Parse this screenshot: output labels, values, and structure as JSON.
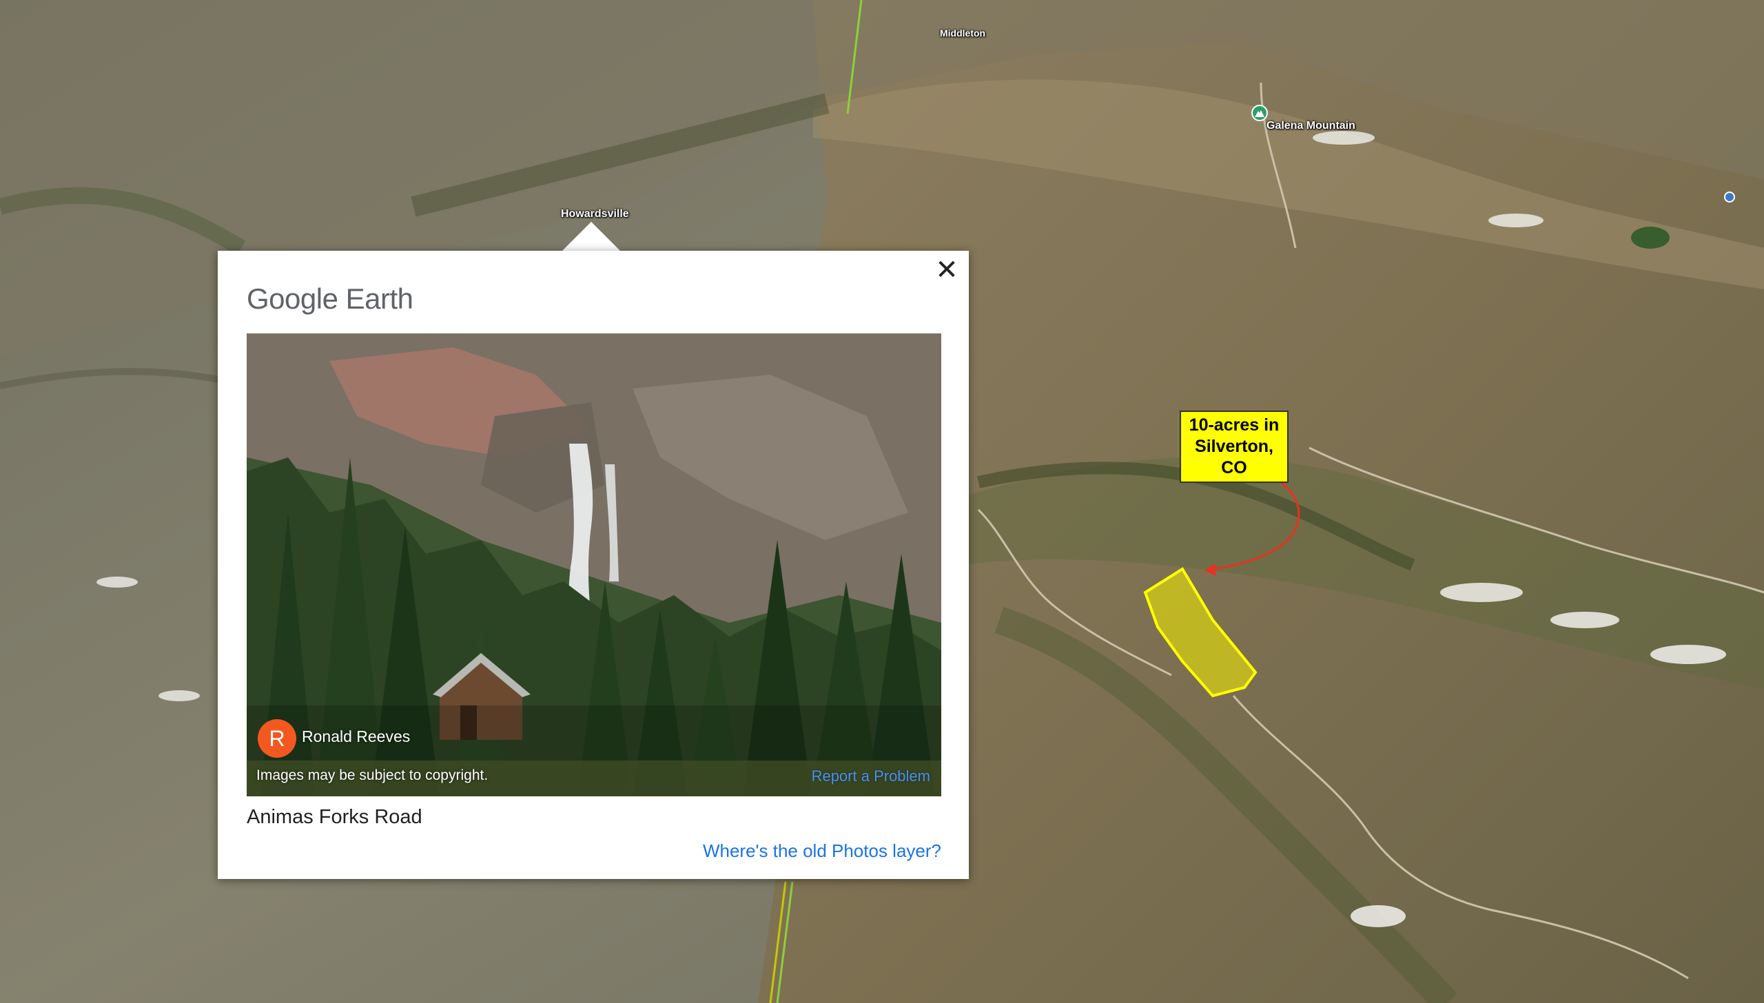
{
  "map": {
    "labels": {
      "middleton": "Middleton",
      "howardsville": "Howardsville",
      "galena": "Galena Mountain"
    },
    "callout": {
      "line1": "10-acres in",
      "line2": "Silverton, CO",
      "highlight_color": "#ffff00",
      "arrow_color": "#e8321f"
    }
  },
  "popup": {
    "brand_google": "Google",
    "brand_earth": "Earth",
    "close_icon": "close-icon",
    "photo": {
      "author_initial": "R",
      "author_name": "Ronald Reeves",
      "copyright": "Images may be subject to copyright.",
      "report": "Report a Problem"
    },
    "place_title": "Animas Forks Road",
    "old_photos_link": "Where's the old Photos layer?",
    "accent_color": "#1a73e8",
    "avatar_color": "#f2581f"
  }
}
